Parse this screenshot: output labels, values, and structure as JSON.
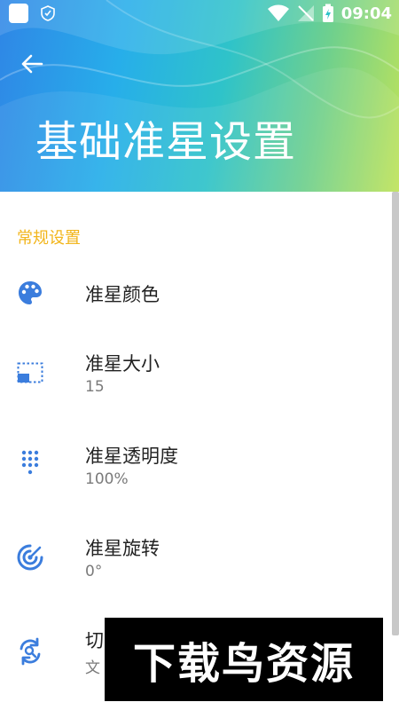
{
  "status_bar": {
    "time": "09:04"
  },
  "page": {
    "title": "基础准星设置"
  },
  "section": {
    "label": "常规设置"
  },
  "settings": [
    {
      "title": "准星颜色",
      "value": ""
    },
    {
      "title": "准星大小",
      "value": "15"
    },
    {
      "title": "准星透明度",
      "value": "100%"
    },
    {
      "title": "准星旋转",
      "value": "0°"
    },
    {
      "title": "切",
      "value": "文"
    }
  ],
  "icons": {
    "back": "arrow-left-icon",
    "color": "palette-icon",
    "size": "selection-size-icon",
    "opacity": "dots-grid-icon",
    "rotation": "radar-icon",
    "switch": "refresh-search-icon"
  },
  "watermark": {
    "text": "下载鸟资源"
  },
  "colors": {
    "accent": "#f2b51b",
    "icon": "#3b7ddd",
    "header_start": "#2f86e6",
    "header_end": "#bfe35a"
  }
}
